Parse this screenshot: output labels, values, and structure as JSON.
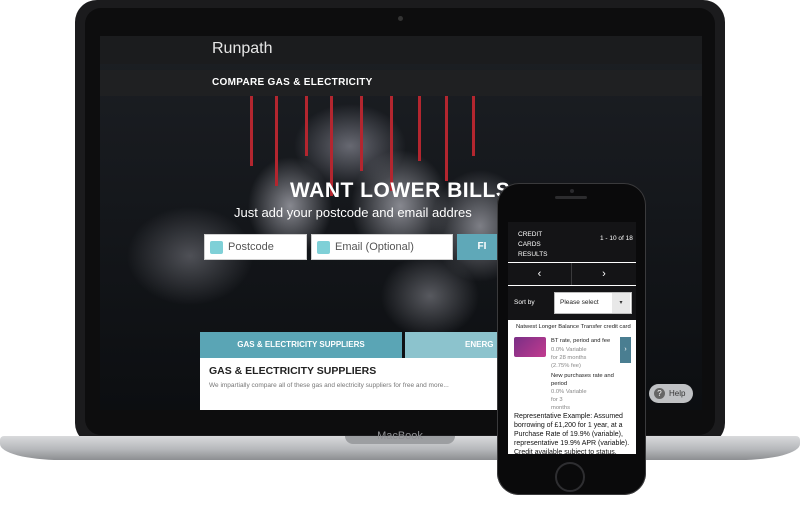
{
  "laptop": {
    "brand": "MacBook"
  },
  "site": {
    "logo": "Runpath",
    "nav_title": "COMPARE GAS & ELECTRICITY",
    "headline": "WANT LOWER BILLS",
    "subline": "Just add your postcode and email addres",
    "postcode_placeholder": "Postcode",
    "email_placeholder": "Email (Optional)",
    "find_label": "FI",
    "tabs": [
      "GAS & ELECTRICITY SUPPLIERS",
      "ENERG"
    ],
    "panel_heading": "GAS & ELECTRICITY SUPPLIERS",
    "panel_text": "We impartially compare all of these gas and electricity suppliers for free and more...",
    "help_label": "Help",
    "help_icon": "?"
  },
  "phone": {
    "header_title_lines": [
      "CREDIT",
      "CARDS",
      "RESULTS"
    ],
    "results_count": "1 - 10 of 18",
    "prev_icon": "‹",
    "next_icon": "›",
    "sort_label": "Sort by",
    "sort_value": "Please select",
    "sort_caret": "▾",
    "product_name": "Natwest Longer Balance Transfer credit card",
    "bt_label": "BT rate, period and fee",
    "bt_rate": "0.0% Variable",
    "bt_period": "for 28 months",
    "bt_fee": "(2.75% fee)",
    "np_label_1": "New purchases rate and",
    "np_label_2": "period",
    "np_rate": "0.0% Variable",
    "np_period_1": "for 3",
    "np_period_2": "months",
    "details_arrow": "›",
    "rep_example": "Representative Example: Assumed borrowing of £1,200 for 1 year, at a Purchase Rate of 19.9% (variable), representative 19.9% APR (variable). Credit available subject to status."
  }
}
